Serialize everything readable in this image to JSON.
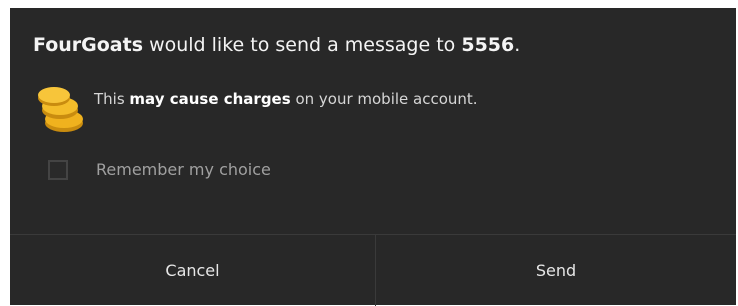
{
  "dialog": {
    "title": {
      "app_name": "FourGoats",
      "middle": " would like to send a message to ",
      "number": "5556",
      "end": "."
    },
    "charges": {
      "icon": "coins-icon",
      "pre": "This ",
      "bold": "may cause charges",
      "post": " on your mobile account."
    },
    "remember": {
      "label": "Remember my choice",
      "checked": false
    },
    "buttons": {
      "cancel": "Cancel",
      "send": "Send"
    },
    "colors": {
      "background": "#282828",
      "coin": "#f0b21e"
    }
  }
}
